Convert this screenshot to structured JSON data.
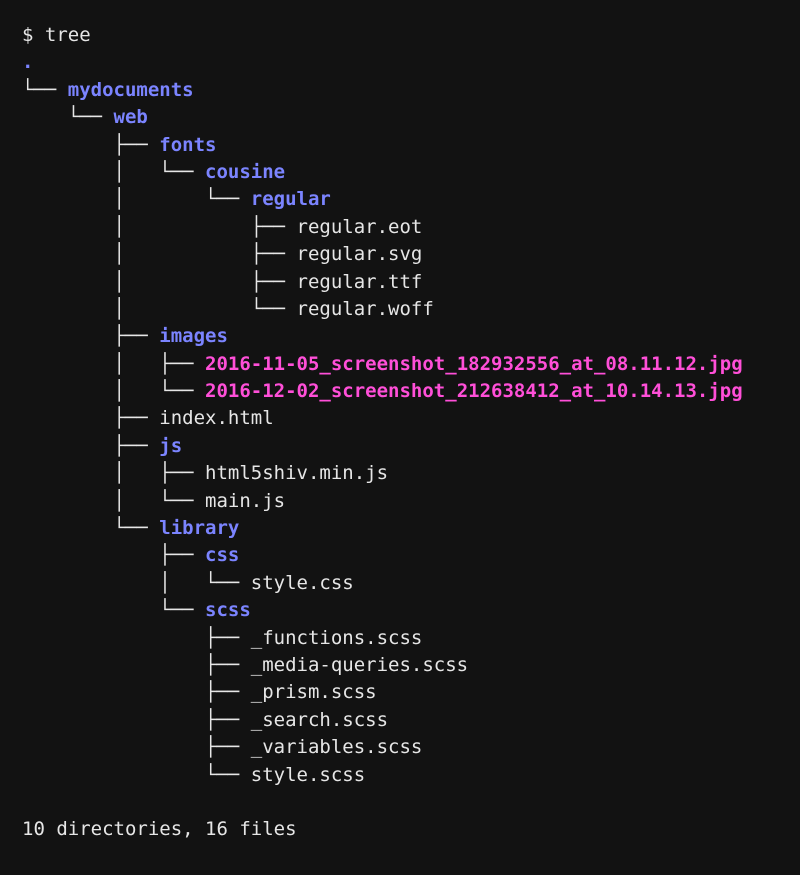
{
  "terminal": {
    "prompt": "$ tree",
    "summary": "10 directories, 16 files",
    "colors": {
      "background": "#121212",
      "text": "#e6e6e6",
      "directory": "#7b84ff",
      "image": "#ff4fd8"
    }
  },
  "tree": [
    {
      "prefix": "",
      "name": ".",
      "type": "dir"
    },
    {
      "prefix": "└── ",
      "name": "mydocuments",
      "type": "dir"
    },
    {
      "prefix": "    └── ",
      "name": "web",
      "type": "dir"
    },
    {
      "prefix": "        ├── ",
      "name": "fonts",
      "type": "dir"
    },
    {
      "prefix": "        │   └── ",
      "name": "cousine",
      "type": "dir"
    },
    {
      "prefix": "        │       └── ",
      "name": "regular",
      "type": "dir"
    },
    {
      "prefix": "        │           ├── ",
      "name": "regular.eot",
      "type": "file"
    },
    {
      "prefix": "        │           ├── ",
      "name": "regular.svg",
      "type": "file"
    },
    {
      "prefix": "        │           ├── ",
      "name": "regular.ttf",
      "type": "file"
    },
    {
      "prefix": "        │           └── ",
      "name": "regular.woff",
      "type": "file"
    },
    {
      "prefix": "        ├── ",
      "name": "images",
      "type": "dir"
    },
    {
      "prefix": "        │   ├── ",
      "name": "2016-11-05_screenshot_182932556_at_08.11.12.jpg",
      "type": "img"
    },
    {
      "prefix": "        │   └── ",
      "name": "2016-12-02_screenshot_212638412_at_10.14.13.jpg",
      "type": "img"
    },
    {
      "prefix": "        ├── ",
      "name": "index.html",
      "type": "file"
    },
    {
      "prefix": "        ├── ",
      "name": "js",
      "type": "dir"
    },
    {
      "prefix": "        │   ├── ",
      "name": "html5shiv.min.js",
      "type": "file"
    },
    {
      "prefix": "        │   └── ",
      "name": "main.js",
      "type": "file"
    },
    {
      "prefix": "        └── ",
      "name": "library",
      "type": "dir"
    },
    {
      "prefix": "            ├── ",
      "name": "css",
      "type": "dir"
    },
    {
      "prefix": "            │   └── ",
      "name": "style.css",
      "type": "file"
    },
    {
      "prefix": "            └── ",
      "name": "scss",
      "type": "dir"
    },
    {
      "prefix": "                ├── ",
      "name": "_functions.scss",
      "type": "file"
    },
    {
      "prefix": "                ├── ",
      "name": "_media-queries.scss",
      "type": "file"
    },
    {
      "prefix": "                ├── ",
      "name": "_prism.scss",
      "type": "file"
    },
    {
      "prefix": "                ├── ",
      "name": "_search.scss",
      "type": "file"
    },
    {
      "prefix": "                ├── ",
      "name": "_variables.scss",
      "type": "file"
    },
    {
      "prefix": "                └── ",
      "name": "style.scss",
      "type": "file"
    }
  ]
}
